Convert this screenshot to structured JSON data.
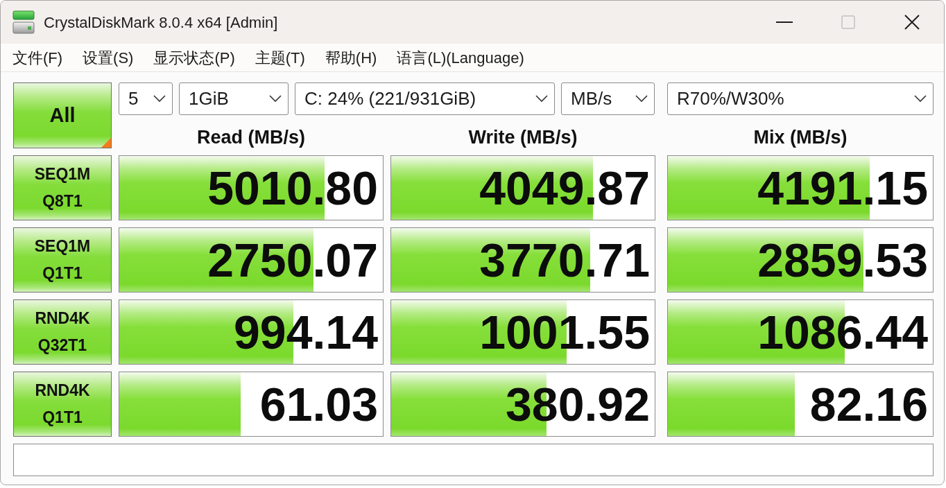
{
  "window": {
    "title": "CrystalDiskMark 8.0.4 x64 [Admin]",
    "controls": [
      {
        "kind": "minimize",
        "disabled": false
      },
      {
        "kind": "maximize",
        "disabled": true
      },
      {
        "kind": "close",
        "disabled": false
      }
    ]
  },
  "menu": [
    "文件(F)",
    "设置(S)",
    "显示状态(P)",
    "主题(T)",
    "帮助(H)",
    "语言(L)(Language)"
  ],
  "all_button": {
    "label": "All"
  },
  "dropdowns": [
    {
      "value": "5"
    },
    {
      "value": "1GiB"
    },
    {
      "value": "C: 24% (221/931GiB)"
    },
    {
      "value": "MB/s"
    },
    {
      "value": "R70%/W30%"
    }
  ],
  "columns": [
    "Read (MB/s)",
    "Write (MB/s)",
    "Mix (MB/s)"
  ],
  "tests": [
    {
      "test": "SEQ1M",
      "queue": "Q8T1",
      "results": [
        {
          "value": "5010.80",
          "level": 0.78
        },
        {
          "value": "4049.87",
          "level": 0.767
        },
        {
          "value": "4191.15",
          "level": 0.763
        }
      ]
    },
    {
      "test": "SEQ1M",
      "queue": "Q1T1",
      "results": [
        {
          "value": "2750.07",
          "level": 0.738
        },
        {
          "value": "3770.71",
          "level": 0.754
        },
        {
          "value": "2859.53",
          "level": 0.737
        }
      ]
    },
    {
      "test": "RND4K",
      "queue": "Q32T1",
      "results": [
        {
          "value": "994.14",
          "level": 0.66
        },
        {
          "value": "1001.55",
          "level": 0.667
        },
        {
          "value": "1086.44",
          "level": 0.667
        }
      ]
    },
    {
      "test": "RND4K",
      "queue": "Q1T1",
      "results": [
        {
          "value": "61.03",
          "level": 0.46
        },
        {
          "value": "380.92",
          "level": 0.59
        },
        {
          "value": "82.16",
          "level": 0.48
        }
      ]
    }
  ]
}
